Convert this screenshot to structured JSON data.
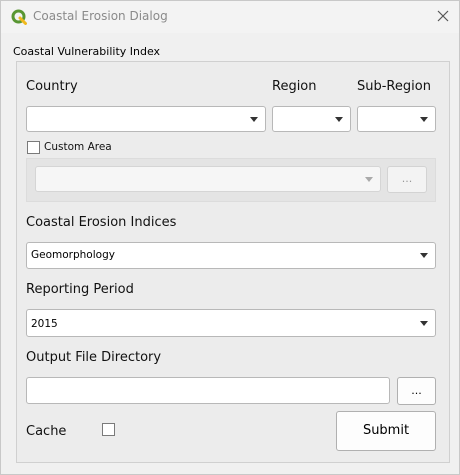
{
  "window": {
    "title": "Coastal Erosion Dialog",
    "close_icon": "close-icon",
    "app_icon": "qgis-logo-icon",
    "accent_color": "#589632"
  },
  "group": {
    "title": "Coastal Vulnerability Index"
  },
  "location": {
    "country_label": "Country",
    "country_value": "",
    "region_label": "Region",
    "region_value": "",
    "subregion_label": "Sub-Region",
    "subregion_value": "",
    "custom_area_label": "Custom Area",
    "custom_area_checked": false,
    "custom_area_value": "",
    "custom_area_browse_label": "..."
  },
  "indices": {
    "label": "Coastal Erosion Indices",
    "selected": "Geomorphology"
  },
  "reporting": {
    "label": "Reporting Period",
    "selected": "2015"
  },
  "output": {
    "label": "Output File Directory",
    "value": "",
    "browse_label": "..."
  },
  "footer": {
    "cache_label": "Cache",
    "cache_checked": false,
    "submit_label": "Submit"
  }
}
